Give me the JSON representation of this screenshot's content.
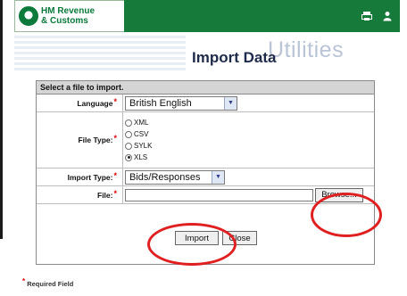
{
  "header": {
    "logo_line1": "HM Revenue",
    "logo_line2": "& Customs",
    "icons": [
      "print-icon",
      "person-icon"
    ]
  },
  "page": {
    "section_title": "Utilities",
    "title": "Import Data"
  },
  "form": {
    "heading": "Select a file to import.",
    "language": {
      "label": "Language",
      "value": "British English"
    },
    "file_type": {
      "label": "File Type:",
      "options": [
        "XML",
        "CSV",
        "SYLK",
        "XLS"
      ],
      "selected": "XLS"
    },
    "import_type": {
      "label": "Import Type:",
      "value": "Bids/Responses"
    },
    "file": {
      "label": "File:",
      "value": "",
      "browse_label": "Browse..."
    },
    "buttons": {
      "import": "Import",
      "close": "Close"
    }
  },
  "footnote": {
    "required_marker": "*",
    "text": "Required Field"
  },
  "colors": {
    "header_green": "#167a3a",
    "highlight_red": "#e02020",
    "required_red": "#e00000"
  }
}
